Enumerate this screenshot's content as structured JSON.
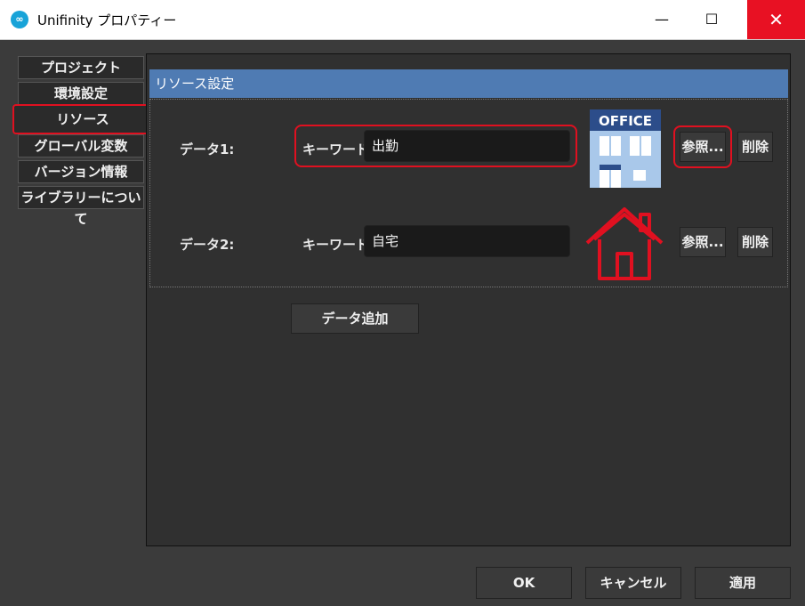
{
  "window": {
    "title": "Unifinity プロパティー",
    "app_icon_text": "∞",
    "minimize": "—",
    "maximize": "☐",
    "close": "✕"
  },
  "tabs": [
    "プロジェクト",
    "環境設定",
    "リソース",
    "グローバル変数",
    "バージョン情報",
    "ライブラリーについて"
  ],
  "active_tab": "リソース",
  "section": {
    "title": "リソース設定",
    "rows": [
      {
        "label": "データ1:",
        "keyword_label": "キーワード:",
        "keyword_value": "出勤",
        "image": "office-image",
        "image_text": "OFFICE",
        "browse": "参照...",
        "delete": "削除"
      },
      {
        "label": "データ2:",
        "keyword_label": "キーワード:",
        "keyword_value": "自宅",
        "image": "house-image",
        "browse": "参照...",
        "delete": "削除"
      }
    ],
    "add_button": "データ追加"
  },
  "footer": {
    "ok": "OK",
    "cancel": "キャンセル",
    "apply": "適用"
  },
  "colors": {
    "accent": "#4f7bb3",
    "highlight": "#e01020",
    "close": "#e81123"
  }
}
